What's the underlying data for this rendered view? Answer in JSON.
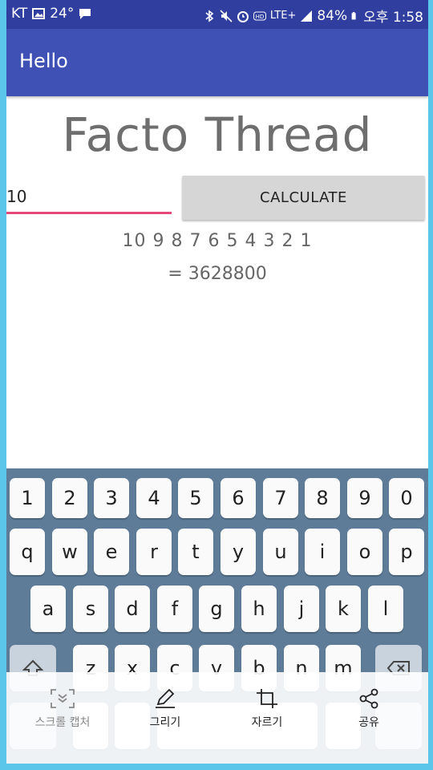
{
  "status": {
    "carrier": "KT",
    "temp": "24°",
    "network": "LTE+",
    "battery": "84%",
    "time": "오후 1:58"
  },
  "appbar": {
    "title": "Hello"
  },
  "main": {
    "heading": "Facto Thread",
    "input_value": "10",
    "button_label": "CALCULATE",
    "sequence": "10 9 8 7 6 5 4 3 2 1",
    "result": "= 3628800"
  },
  "keyboard": {
    "row_numbers": [
      "1",
      "2",
      "3",
      "4",
      "5",
      "6",
      "7",
      "8",
      "9",
      "0"
    ],
    "row_top": [
      "q",
      "w",
      "e",
      "r",
      "t",
      "y",
      "u",
      "i",
      "o",
      "p"
    ],
    "row_mid": [
      "a",
      "s",
      "d",
      "f",
      "g",
      "h",
      "j",
      "k",
      "l"
    ],
    "row_bottom": [
      "z",
      "x",
      "c",
      "v",
      "b",
      "n",
      "m"
    ]
  },
  "capture_toolbar": {
    "scroll_capture": "스크롤 캡처",
    "draw": "그리기",
    "crop": "자르기",
    "share": "공유"
  },
  "colors": {
    "statusbar": "#303f9f",
    "appbar": "#3f51b5",
    "accent": "#e64a7b",
    "keyboard_bg": "#5e7c98",
    "frame": "#5bc6ea"
  }
}
